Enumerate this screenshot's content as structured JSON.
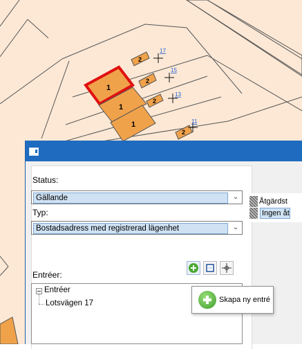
{
  "map": {
    "house_numbers": [
      "17",
      "15",
      "13",
      "11"
    ],
    "building_floors": [
      "1",
      "1",
      "1",
      "2",
      "2",
      "2",
      "2"
    ],
    "colors": {
      "parcel": "#fce8d5",
      "building": "#f0a24a",
      "selected": "#e01010",
      "line": "#555555"
    }
  },
  "dialog": {
    "status_label": "Status:",
    "status_value": "Gällande",
    "type_label": "Typ:",
    "type_value": "Bostadsadress med registrerad lägenhet",
    "entrances_label": "Entréer:",
    "tree_root": "Entréer",
    "tree_child": "Lotsvägen 17",
    "tools": [
      "add-icon",
      "frame-icon",
      "crosshair-icon"
    ],
    "accent": "#1f6bbf"
  },
  "side_table": {
    "header": "Åtgärdst",
    "row": "Ingen åt"
  },
  "tooltip": {
    "text": "Skapa ny entré"
  }
}
